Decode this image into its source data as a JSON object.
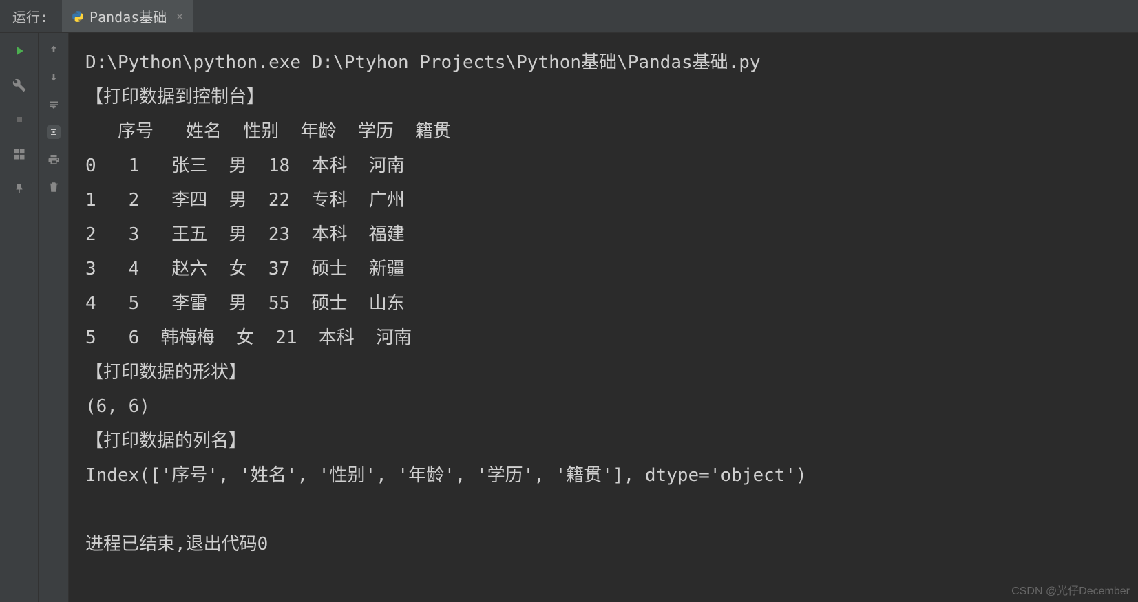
{
  "topbar": {
    "run_label": "运行:",
    "tab_title": "Pandas基础"
  },
  "console": {
    "line1": "D:\\Python\\python.exe D:\\Ptyhon_Projects\\Python基础\\Pandas基础.py",
    "section1": "【打印数据到控制台】",
    "header": "   序号   姓名  性别  年龄  学历  籍贯",
    "rows": [
      "0   1   张三  男  18  本科  河南",
      "1   2   李四  男  22  专科  广州",
      "2   3   王五  男  23  本科  福建",
      "3   4   赵六  女  37  硕士  新疆",
      "4   5   李雷  男  55  硕士  山东",
      "5   6  韩梅梅  女  21  本科  河南"
    ],
    "section2": "【打印数据的形状】",
    "shape": "(6, 6)",
    "section3": "【打印数据的列名】",
    "index_line": "Index(['序号', '姓名', '性别', '年龄', '学历', '籍贯'], dtype='object')",
    "blank": "",
    "exit_line": "进程已结束,退出代码0"
  },
  "watermark": "CSDN @光仔December"
}
